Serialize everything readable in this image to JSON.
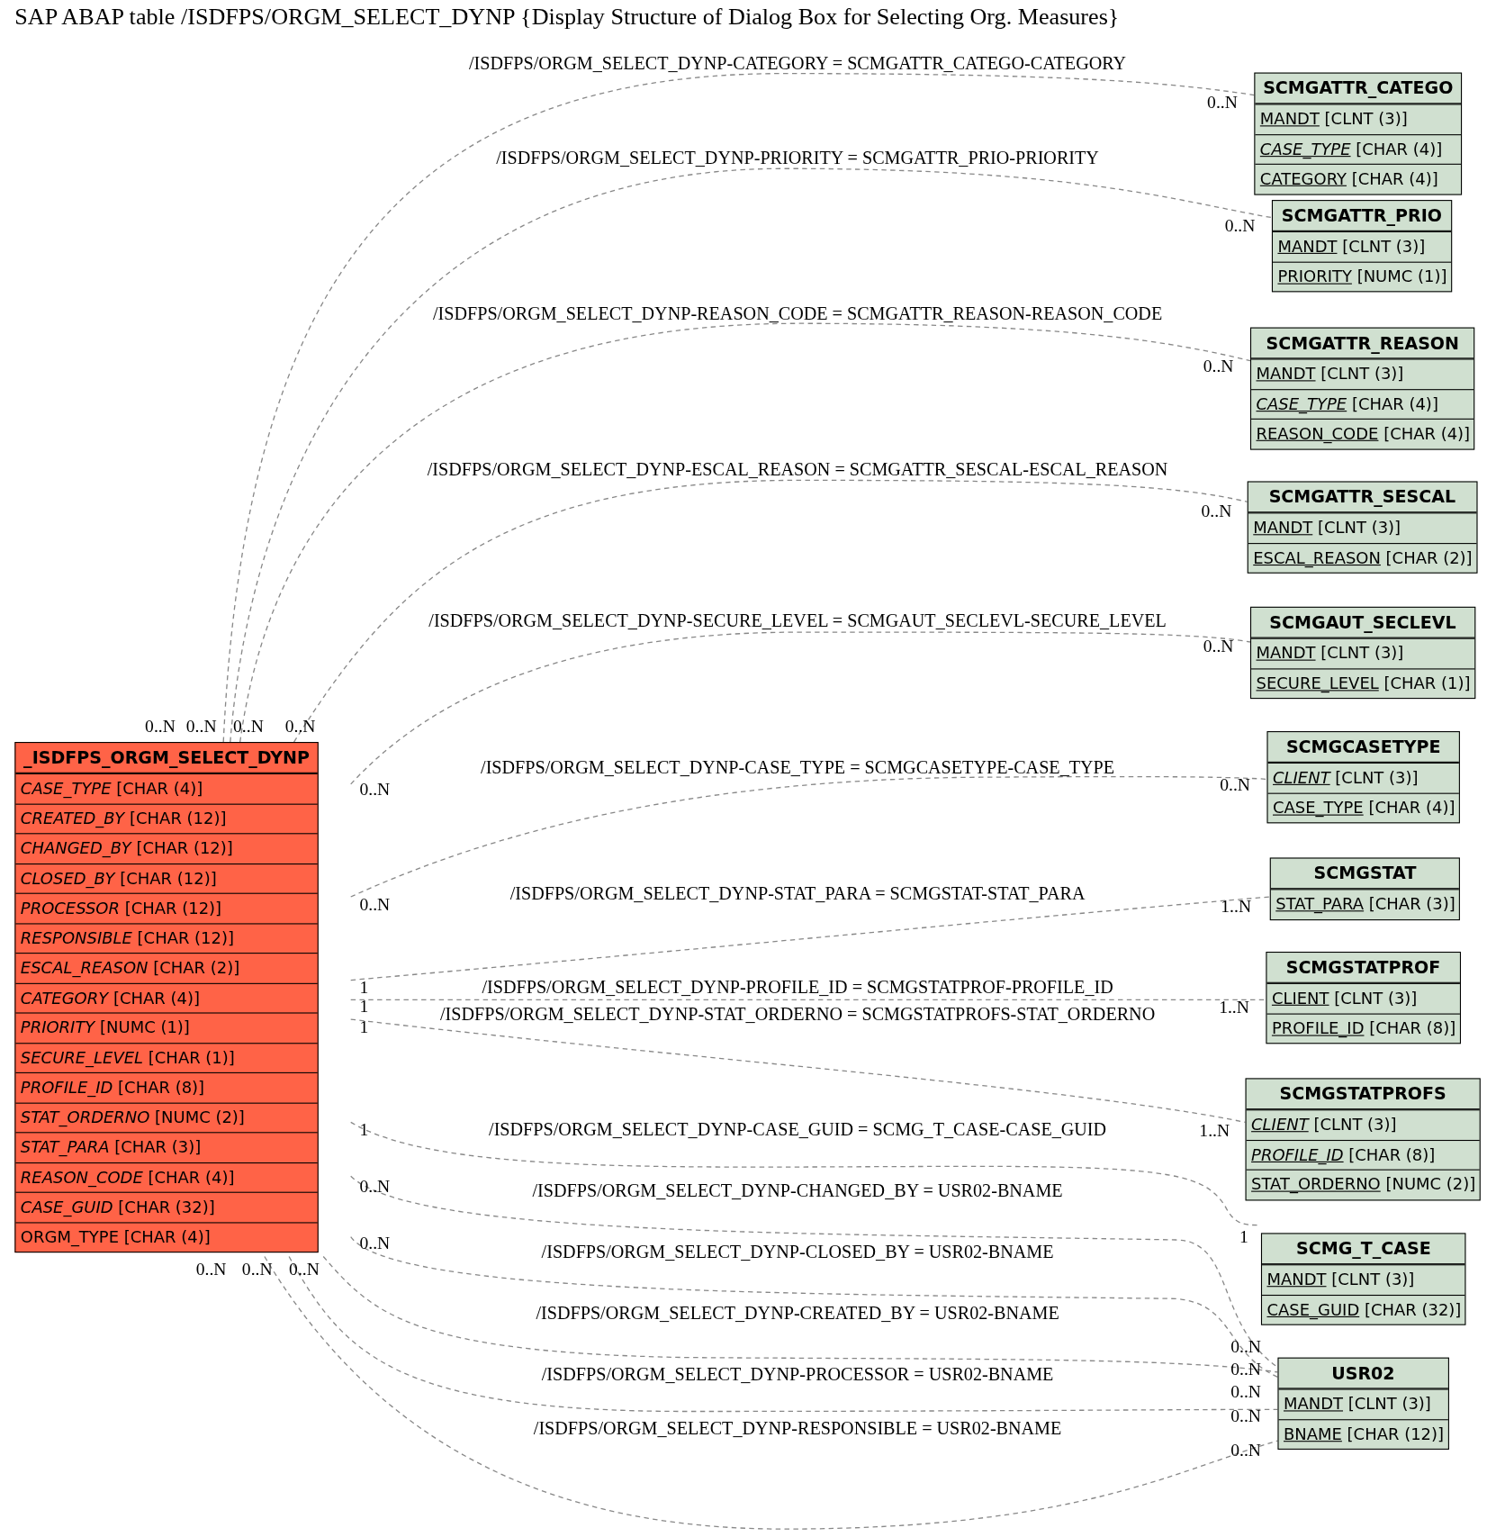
{
  "title": "SAP ABAP table /ISDFPS/ORGM_SELECT_DYNP {Display Structure of Dialog Box for Selecting Org. Measures}",
  "main_table": {
    "name": "_ISDFPS_ORGM_SELECT_DYNP",
    "fields": [
      {
        "name": "CASE_TYPE",
        "type": "[CHAR (4)]",
        "key": false,
        "foreign": true
      },
      {
        "name": "CREATED_BY",
        "type": "[CHAR (12)]",
        "key": false,
        "foreign": true
      },
      {
        "name": "CHANGED_BY",
        "type": "[CHAR (12)]",
        "key": false,
        "foreign": true
      },
      {
        "name": "CLOSED_BY",
        "type": "[CHAR (12)]",
        "key": false,
        "foreign": true
      },
      {
        "name": "PROCESSOR",
        "type": "[CHAR (12)]",
        "key": false,
        "foreign": true
      },
      {
        "name": "RESPONSIBLE",
        "type": "[CHAR (12)]",
        "key": false,
        "foreign": true
      },
      {
        "name": "ESCAL_REASON",
        "type": "[CHAR (2)]",
        "key": false,
        "foreign": true
      },
      {
        "name": "CATEGORY",
        "type": "[CHAR (4)]",
        "key": false,
        "foreign": true
      },
      {
        "name": "PRIORITY",
        "type": "[NUMC (1)]",
        "key": false,
        "foreign": true
      },
      {
        "name": "SECURE_LEVEL",
        "type": "[CHAR (1)]",
        "key": false,
        "foreign": true
      },
      {
        "name": "PROFILE_ID",
        "type": "[CHAR (8)]",
        "key": false,
        "foreign": true
      },
      {
        "name": "STAT_ORDERNO",
        "type": "[NUMC (2)]",
        "key": false,
        "foreign": true
      },
      {
        "name": "STAT_PARA",
        "type": "[CHAR (3)]",
        "key": false,
        "foreign": true
      },
      {
        "name": "REASON_CODE",
        "type": "[CHAR (4)]",
        "key": false,
        "foreign": true
      },
      {
        "name": "CASE_GUID",
        "type": "[CHAR (32)]",
        "key": false,
        "foreign": true
      },
      {
        "name": "ORGM_TYPE",
        "type": "[CHAR (4)]",
        "key": false,
        "foreign": false
      }
    ]
  },
  "tables": [
    {
      "name": "SCMGATTR_CATEGO",
      "fields": [
        {
          "name": "MANDT",
          "type": "[CLNT (3)]",
          "key": true,
          "foreign": false
        },
        {
          "name": "CASE_TYPE",
          "type": "[CHAR (4)]",
          "key": true,
          "foreign": true
        },
        {
          "name": "CATEGORY",
          "type": "[CHAR (4)]",
          "key": true,
          "foreign": false
        }
      ]
    },
    {
      "name": "SCMGATTR_PRIO",
      "fields": [
        {
          "name": "MANDT",
          "type": "[CLNT (3)]",
          "key": true,
          "foreign": false
        },
        {
          "name": "PRIORITY",
          "type": "[NUMC (1)]",
          "key": true,
          "foreign": false
        }
      ]
    },
    {
      "name": "SCMGATTR_REASON",
      "fields": [
        {
          "name": "MANDT",
          "type": "[CLNT (3)]",
          "key": true,
          "foreign": false
        },
        {
          "name": "CASE_TYPE",
          "type": "[CHAR (4)]",
          "key": true,
          "foreign": true
        },
        {
          "name": "REASON_CODE",
          "type": "[CHAR (4)]",
          "key": true,
          "foreign": false
        }
      ]
    },
    {
      "name": "SCMGATTR_SESCAL",
      "fields": [
        {
          "name": "MANDT",
          "type": "[CLNT (3)]",
          "key": true,
          "foreign": false
        },
        {
          "name": "ESCAL_REASON",
          "type": "[CHAR (2)]",
          "key": true,
          "foreign": false
        }
      ]
    },
    {
      "name": "SCMGAUT_SECLEVL",
      "fields": [
        {
          "name": "MANDT",
          "type": "[CLNT (3)]",
          "key": true,
          "foreign": false
        },
        {
          "name": "SECURE_LEVEL",
          "type": "[CHAR (1)]",
          "key": true,
          "foreign": false
        }
      ]
    },
    {
      "name": "SCMGCASETYPE",
      "fields": [
        {
          "name": "CLIENT",
          "type": "[CLNT (3)]",
          "key": true,
          "foreign": true
        },
        {
          "name": "CASE_TYPE",
          "type": "[CHAR (4)]",
          "key": true,
          "foreign": false
        }
      ]
    },
    {
      "name": "SCMGSTAT",
      "fields": [
        {
          "name": "STAT_PARA",
          "type": "[CHAR (3)]",
          "key": true,
          "foreign": false
        }
      ]
    },
    {
      "name": "SCMGSTATPROF",
      "fields": [
        {
          "name": "CLIENT",
          "type": "[CLNT (3)]",
          "key": true,
          "foreign": false
        },
        {
          "name": "PROFILE_ID",
          "type": "[CHAR (8)]",
          "key": true,
          "foreign": false
        }
      ]
    },
    {
      "name": "SCMGSTATPROFS",
      "fields": [
        {
          "name": "CLIENT",
          "type": "[CLNT (3)]",
          "key": true,
          "foreign": true
        },
        {
          "name": "PROFILE_ID",
          "type": "[CHAR (8)]",
          "key": true,
          "foreign": true
        },
        {
          "name": "STAT_ORDERNO",
          "type": "[NUMC (2)]",
          "key": true,
          "foreign": false
        }
      ]
    },
    {
      "name": "SCMG_T_CASE",
      "fields": [
        {
          "name": "MANDT",
          "type": "[CLNT (3)]",
          "key": true,
          "foreign": false
        },
        {
          "name": "CASE_GUID",
          "type": "[CHAR (32)]",
          "key": true,
          "foreign": false
        }
      ]
    },
    {
      "name": "USR02",
      "fields": [
        {
          "name": "MANDT",
          "type": "[CLNT (3)]",
          "key": true,
          "foreign": false
        },
        {
          "name": "BNAME",
          "type": "[CHAR (12)]",
          "key": true,
          "foreign": false
        }
      ]
    }
  ],
  "relations": [
    {
      "label": "/ISDFPS/ORGM_SELECT_DYNP-CATEGORY = SCMGATTR_CATEGO-CATEGORY",
      "source_card": "0..N",
      "target_card": "0..N"
    },
    {
      "label": "/ISDFPS/ORGM_SELECT_DYNP-PRIORITY = SCMGATTR_PRIO-PRIORITY",
      "source_card": "0..N",
      "target_card": "0..N"
    },
    {
      "label": "/ISDFPS/ORGM_SELECT_DYNP-REASON_CODE = SCMGATTR_REASON-REASON_CODE",
      "source_card": "0..N",
      "target_card": "0..N"
    },
    {
      "label": "/ISDFPS/ORGM_SELECT_DYNP-ESCAL_REASON = SCMGATTR_SESCAL-ESCAL_REASON",
      "source_card": "0..N",
      "target_card": "0..N"
    },
    {
      "label": "/ISDFPS/ORGM_SELECT_DYNP-SECURE_LEVEL = SCMGAUT_SECLEVL-SECURE_LEVEL",
      "source_card": "0..N",
      "target_card": "0..N"
    },
    {
      "label": "/ISDFPS/ORGM_SELECT_DYNP-CASE_TYPE = SCMGCASETYPE-CASE_TYPE",
      "source_card": "0..N",
      "target_card": "0..N"
    },
    {
      "label": "/ISDFPS/ORGM_SELECT_DYNP-STAT_PARA = SCMGSTAT-STAT_PARA",
      "source_card": "1",
      "target_card": "1..N"
    },
    {
      "label": "/ISDFPS/ORGM_SELECT_DYNP-PROFILE_ID = SCMGSTATPROF-PROFILE_ID",
      "source_card": "1",
      "target_card": "1..N"
    },
    {
      "label": "/ISDFPS/ORGM_SELECT_DYNP-STAT_ORDERNO = SCMGSTATPROFS-STAT_ORDERNO",
      "source_card": "1",
      "target_card": "1..N"
    },
    {
      "label": "/ISDFPS/ORGM_SELECT_DYNP-CASE_GUID = SCMG_T_CASE-CASE_GUID",
      "source_card": "1",
      "target_card": "1"
    },
    {
      "label": "/ISDFPS/ORGM_SELECT_DYNP-CHANGED_BY = USR02-BNAME",
      "source_card": "0..N",
      "target_card": "0..N"
    },
    {
      "label": "/ISDFPS/ORGM_SELECT_DYNP-CLOSED_BY = USR02-BNAME",
      "source_card": "0..N",
      "target_card": "0..N"
    },
    {
      "label": "/ISDFPS/ORGM_SELECT_DYNP-CREATED_BY = USR02-BNAME",
      "source_card": "0..N",
      "target_card": "0..N"
    },
    {
      "label": "/ISDFPS/ORGM_SELECT_DYNP-PROCESSOR = USR02-BNAME",
      "source_card": "0..N",
      "target_card": "0..N"
    },
    {
      "label": "/ISDFPS/ORGM_SELECT_DYNP-RESPONSIBLE = USR02-BNAME",
      "source_card": "0..N",
      "target_card": "0..N"
    }
  ]
}
